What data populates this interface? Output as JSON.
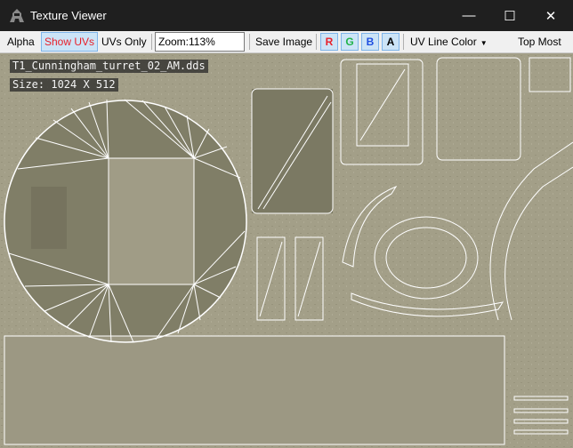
{
  "window": {
    "title": "Texture Viewer",
    "minimize_glyph": "—",
    "maximize_glyph": "☐",
    "close_glyph": "✕"
  },
  "toolbar": {
    "alpha_label": "Alpha",
    "show_uvs_label": "Show UVs",
    "uvs_only_label": "UVs Only",
    "zoom_value": "Zoom:113%",
    "save_image_label": "Save Image",
    "channels": [
      {
        "label": "R",
        "color": "#e8212b"
      },
      {
        "label": "G",
        "color": "#21b34a"
      },
      {
        "label": "B",
        "color": "#1f4fe0"
      },
      {
        "label": "A",
        "color": "#000000"
      }
    ],
    "uv_line_color_label": "UV Line Color",
    "top_most_label": "Top Most"
  },
  "texture": {
    "file_name": "T1_Cunningham_turret_02_AM.dds",
    "size_text": "Size: 1024 X 512"
  },
  "colors": {
    "texture_base": "#a39f88",
    "texture_panel": "#7f7d66",
    "uv_line": "#ffffff",
    "active_toggle": "#cce4f7"
  }
}
